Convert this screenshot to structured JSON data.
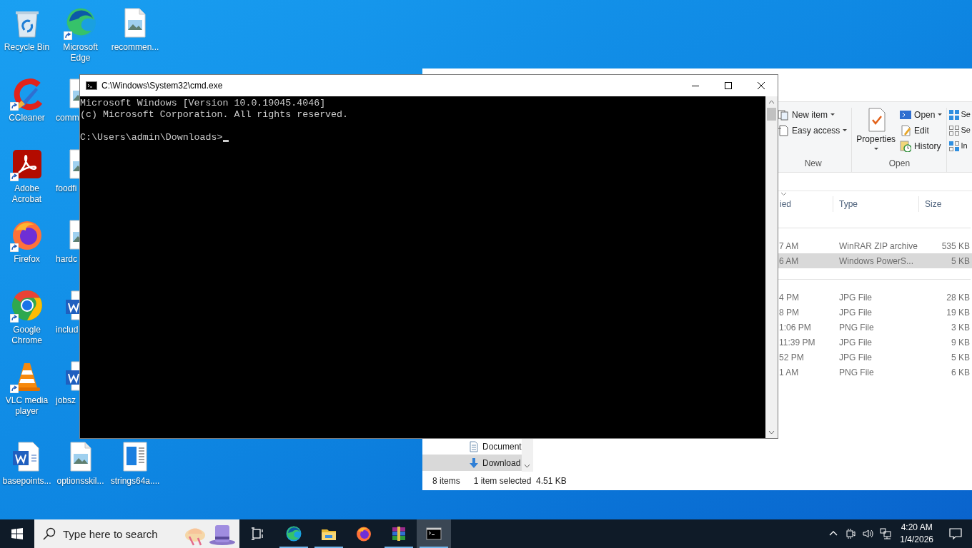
{
  "desktop_rows": [
    [
      {
        "label": "Recycle Bin",
        "kind": "recycle"
      },
      {
        "label": "Microsoft Edge",
        "kind": "edge",
        "shortcut": true
      },
      {
        "label": "recommen...",
        "kind": "image"
      }
    ],
    [
      {
        "label": "CCleaner",
        "kind": "ccleaner",
        "shortcut": true
      },
      {
        "label": "comm",
        "kind": "image",
        "clipped": true
      },
      null
    ],
    [
      {
        "label": "Adobe Acrobat",
        "kind": "acrobat",
        "shortcut": true
      },
      {
        "label": "foodfi",
        "kind": "image",
        "clipped": true
      },
      null
    ],
    [
      {
        "label": "Firefox",
        "kind": "firefox",
        "shortcut": true
      },
      {
        "label": "hardc",
        "kind": "image",
        "clipped": true
      },
      null
    ],
    [
      {
        "label": "Google Chrome",
        "kind": "chrome",
        "shortcut": true
      },
      {
        "label": "includ",
        "kind": "word",
        "clipped": true
      },
      null
    ],
    [
      {
        "label": "VLC media player",
        "kind": "vlc",
        "shortcut": true
      },
      {
        "label": "jobsz",
        "kind": "word",
        "clipped": true
      },
      null
    ],
    [
      {
        "label": "basepoints...",
        "kind": "word"
      },
      {
        "label": "optionsskil...",
        "kind": "image"
      },
      {
        "label": "strings64a....",
        "kind": "strings"
      }
    ]
  ],
  "explorer": {
    "ribbon_groups": [
      {
        "label": "New",
        "items": [
          {
            "label": "New item",
            "kind": "newitem",
            "dropdown": true
          },
          {
            "label": "Easy access",
            "kind": "easyaccess",
            "dropdown": true
          }
        ]
      },
      {
        "label": "Open",
        "large": {
          "label": "Properties",
          "dropdown": true
        },
        "items": [
          {
            "label": "Open",
            "kind": "open",
            "dropdown": true
          },
          {
            "label": "Edit",
            "kind": "edit",
            "dropdown": false
          },
          {
            "label": "History",
            "kind": "history",
            "dropdown": false
          }
        ]
      },
      {
        "items": [
          {
            "label": "Se",
            "kind": "selectall",
            "dropdown": false
          },
          {
            "label": "Se",
            "kind": "selectnone",
            "dropdown": false
          },
          {
            "label": "In",
            "kind": "invert",
            "dropdown": false
          }
        ]
      }
    ],
    "columns": [
      "ied",
      "Type",
      "Size"
    ],
    "file_groups": [
      {
        "rows": [
          {
            "modified": "7 AM",
            "type": "WinRAR ZIP archive",
            "size": "535 KB",
            "selected": false
          },
          {
            "modified": "6 AM",
            "type": "Windows PowerS...",
            "size": "5 KB",
            "selected": true
          }
        ]
      },
      {
        "rows": [
          {
            "modified": "4 PM",
            "type": "JPG File",
            "size": "28 KB",
            "selected": false
          },
          {
            "modified": "8 PM",
            "type": "JPG File",
            "size": "19 KB",
            "selected": false
          },
          {
            "modified": "1:06 PM",
            "type": "PNG File",
            "size": "3 KB",
            "selected": false
          },
          {
            "modified": "11:39 PM",
            "type": "JPG File",
            "size": "9 KB",
            "selected": false
          },
          {
            "modified": "52 PM",
            "type": "JPG File",
            "size": "5 KB",
            "selected": false
          },
          {
            "modified": "1 AM",
            "type": "PNG File",
            "size": "6 KB",
            "selected": false
          }
        ]
      }
    ],
    "nav_items": [
      {
        "label": "Document",
        "kind": "documents",
        "selected": false
      },
      {
        "label": "Download",
        "kind": "downloads",
        "selected": true
      }
    ],
    "status_items": [
      "8 items",
      "1 item selected  4.51 KB"
    ]
  },
  "console": {
    "title": "C:\\Windows\\System32\\cmd.exe",
    "header_lines": [
      "Microsoft Windows [Version 10.0.19045.4046]",
      "(c) Microsoft Corporation. All rights reserved."
    ],
    "prompt": "C:\\Users\\admin\\Downloads>",
    "cursor_visible": true
  },
  "taskbar": {
    "search_placeholder": "Type here to search",
    "apps": [
      {
        "kind": "edge",
        "running": true,
        "active": false
      },
      {
        "kind": "folder",
        "running": true,
        "active": false
      },
      {
        "kind": "firefox",
        "running": false,
        "active": false
      },
      {
        "kind": "winrar",
        "running": true,
        "active": false
      },
      {
        "kind": "cmd",
        "running": true,
        "active": true
      }
    ],
    "time": "4:20 AM",
    "date": "1/4/2026"
  }
}
